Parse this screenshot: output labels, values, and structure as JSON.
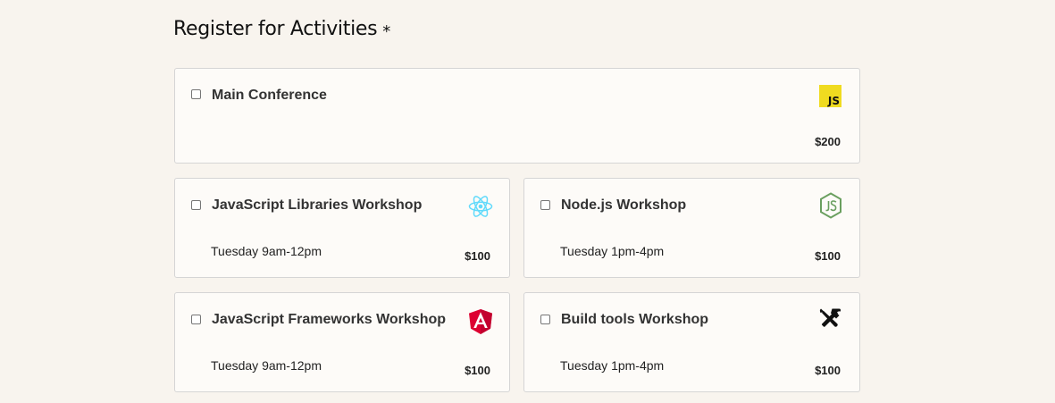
{
  "form": {
    "heading": "Register for Activities",
    "required_mark": "*"
  },
  "activities": [
    {
      "name": "Main Conference",
      "time": "",
      "price": "$200",
      "icon": "javascript-icon",
      "checked": false
    },
    {
      "name": "JavaScript Libraries Workshop",
      "time": "Tuesday 9am-12pm",
      "price": "$100",
      "icon": "react-icon",
      "checked": false
    },
    {
      "name": "Node.js Workshop",
      "time": "Tuesday 1pm-4pm",
      "price": "$100",
      "icon": "nodejs-icon",
      "checked": false
    },
    {
      "name": "JavaScript Frameworks Workshop",
      "time": "Tuesday 9am-12pm",
      "price": "$100",
      "icon": "angular-icon",
      "checked": false
    },
    {
      "name": "Build tools Workshop",
      "time": "Tuesday 1pm-4pm",
      "price": "$100",
      "icon": "tools-icon",
      "checked": false
    }
  ],
  "icons": {
    "js_text": "JS",
    "js_color": "#f0db20",
    "react_color": "#61dafb",
    "node_color": "#6a9f5f",
    "angular_color": "#dd0031"
  }
}
